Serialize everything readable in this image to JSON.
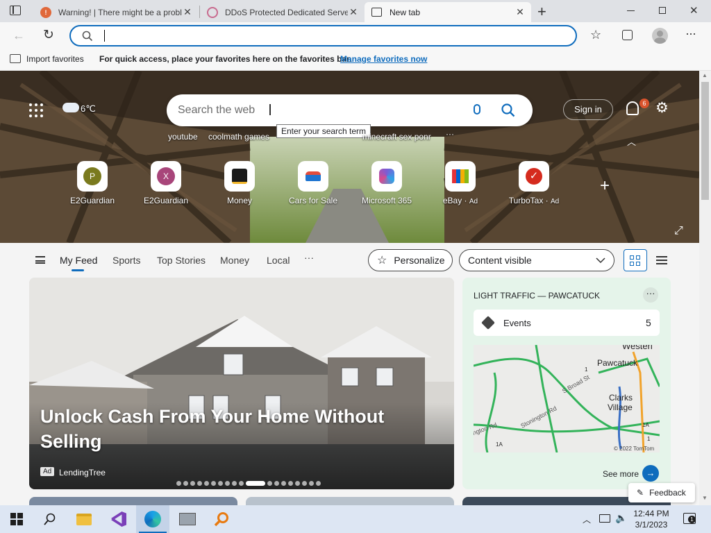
{
  "tabs": [
    {
      "title": "Warning! | There might be a problem",
      "active": false
    },
    {
      "title": "DDoS Protected Dedicated Servers",
      "active": false
    },
    {
      "title": "New tab",
      "active": true
    }
  ],
  "address_bar": {
    "value": "",
    "placeholder": ""
  },
  "favorites_bar": {
    "import_label": "Import favorites",
    "message": "For quick access, place your favorites here on the favorites bar.",
    "manage_link": "Manage favorites now"
  },
  "hero": {
    "weather": "6℃",
    "search_placeholder": "Search the web",
    "tooltip": "Enter your search term",
    "sign_in": "Sign in",
    "notification_count": "6",
    "quick_links": [
      "youtube",
      "coolmath games",
      "…nig…",
      "minecraft sex ponr"
    ],
    "tiles": [
      {
        "label": "E2Guardian",
        "letter": "P",
        "color": "#7a7a1e",
        "ad": ""
      },
      {
        "label": "E2Guardian",
        "letter": "X",
        "color": "#a8457a",
        "ad": ""
      },
      {
        "label": "Money",
        "letter": "",
        "color": "#1a1a1a",
        "ad": ""
      },
      {
        "label": "Cars for Sale",
        "letter": "",
        "color": "#e24c3c",
        "ad": ""
      },
      {
        "label": "Microsoft 365",
        "letter": "",
        "color": "#7b5cd6",
        "ad": ""
      },
      {
        "label": "eBay",
        "letter": "",
        "color": "#e53238",
        "ad": "Ad"
      },
      {
        "label": "TurboTax",
        "letter": "",
        "color": "#d52b1e",
        "ad": "Ad"
      }
    ]
  },
  "feed_nav": {
    "items": [
      "My Feed",
      "Sports",
      "Top Stories",
      "Money",
      "Local"
    ],
    "more": "···",
    "personalize": "Personalize",
    "content_visible": "Content visible"
  },
  "main_card": {
    "headline": "Unlock Cash From Your Home Without Selling",
    "ad_badge": "Ad",
    "source": "LendingTree",
    "carousel_count": 19,
    "carousel_active": 10
  },
  "traffic_card": {
    "title": "LIGHT TRAFFIC — PAWCATUCK",
    "events_label": "Events",
    "events_count": "5",
    "map_labels": [
      "Westerl",
      "Pawcatuck",
      "Clarks",
      "Village",
      "Stonington Rd",
      "S Broad St",
      "ngton Rd",
      "1A",
      "1A",
      "1",
      "1"
    ],
    "map_copyright": "© 2022 TomTom",
    "see_more": "See more"
  },
  "feedback": "Feedback",
  "taskbar": {
    "time": "12:44 PM",
    "date": "3/1/2023",
    "notification_badge": "1"
  }
}
